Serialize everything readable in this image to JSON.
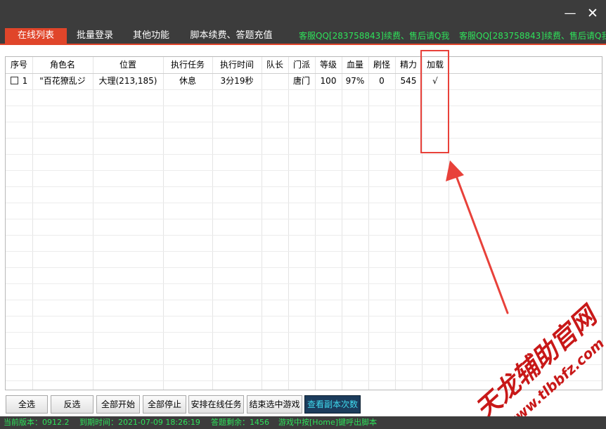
{
  "window": {
    "minimize_glyph": "—",
    "close_glyph": "✕"
  },
  "tabs": [
    {
      "label": "在线列表",
      "active": true
    },
    {
      "label": "批量登录"
    },
    {
      "label": "其他功能"
    },
    {
      "label": "脚本续费、答题充值"
    }
  ],
  "marquee_texts": [
    "客服QQ[283758843]续费、售后请Q我",
    "客服QQ[283758843]续费、售后请Q我"
  ],
  "table": {
    "headers": [
      "序号",
      "角色名",
      "位置",
      "执行任务",
      "执行时间",
      "队长",
      "门派",
      "等级",
      "血量",
      "刷怪",
      "精力",
      "加载"
    ],
    "rows": [
      {
        "index": "1",
        "checked": false,
        "role": "\"百花獠乱ジ",
        "position": "大理(213,185)",
        "task": "休息",
        "time": "3分19秒",
        "leader": "",
        "sect": "唐门",
        "level": "100",
        "hp": "97%",
        "kills": "0",
        "energy": "545",
        "loaded": "√"
      }
    ]
  },
  "buttons": [
    {
      "label": "全选"
    },
    {
      "label": "反选"
    },
    {
      "label": "全部开始"
    },
    {
      "label": "全部停止"
    },
    {
      "label": "安排在线任务"
    },
    {
      "label": "结束选中游戏"
    },
    {
      "label": "查看副本次数",
      "active": true
    }
  ],
  "status": {
    "version": "当前版本：0912.2",
    "expiry": "到期时间：2021-07-09 18:26:19",
    "answers_left": "答题剩余：1456",
    "hint": "游戏中按[Home]键呼出脚本"
  },
  "annotation": {
    "box_color": "#e8413a",
    "arrow_color": "#e8413a"
  },
  "watermark": {
    "line1": "天龙辅助官网",
    "line2": "www.tlbbfz.com",
    "color": "#c81818"
  },
  "colors": {
    "titlebar": "#3c3c3c",
    "tab_active": "#e0452a",
    "marquee_text": "#2ee25a",
    "status_text": "#2ee25a",
    "active_button_bg": "#1c3c5c",
    "active_button_text": "#3fd9ee"
  }
}
